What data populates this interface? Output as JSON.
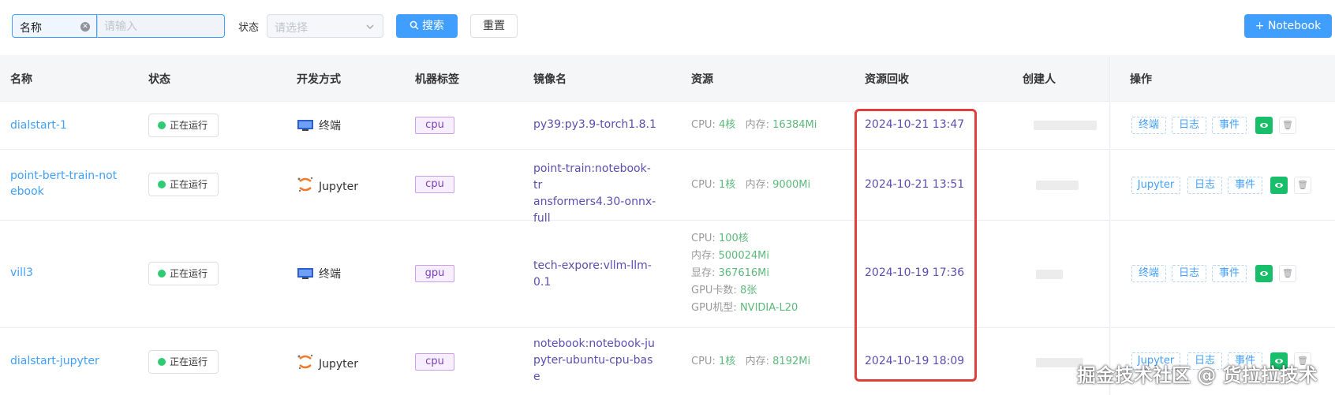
{
  "toolbar": {
    "field_label": "名称",
    "search_placeholder": "请输入",
    "status_label": "状态",
    "status_placeholder": "请选择",
    "search_button": "搜索",
    "reset_button": "重置",
    "new_button": "+ Notebook"
  },
  "table": {
    "headers": {
      "name": "名称",
      "status": "状态",
      "dev_mode": "开发方式",
      "machine_tag": "机器标签",
      "image": "镜像名",
      "resources": "资源",
      "recycle": "资源回收",
      "creator": "创建人",
      "ops": "操作"
    },
    "rows": [
      {
        "name_lines": [
          "dialstart-1"
        ],
        "status": "正在运行",
        "dev_mode": "终端",
        "dev_icon": "terminal-icon",
        "tag": "cpu",
        "image_lines": [
          "py39:py3.9-torch1.8.1"
        ],
        "resources": {
          "cpu_label": "CPU: ",
          "cpu_value": "4核",
          "mem_label": "内存: ",
          "mem_value": "16384Mi"
        },
        "recycle": "2024-10-21 13:47",
        "ops": [
          "终端",
          "日志",
          "事件"
        ]
      },
      {
        "name_lines": [
          "point-bert-train-not",
          "ebook"
        ],
        "status": "正在运行",
        "dev_mode": "Jupyter",
        "dev_icon": "jupyter-icon",
        "tag": "cpu",
        "image_lines": [
          "point-train:notebook-tr",
          "ansformers4.30-onnx-",
          "full"
        ],
        "resources": {
          "cpu_label": "CPU: ",
          "cpu_value": "1核",
          "mem_label": "内存: ",
          "mem_value": "9000Mi"
        },
        "recycle": "2024-10-21 13:51",
        "ops": [
          "Jupyter",
          "日志",
          "事件"
        ]
      },
      {
        "name_lines": [
          "vill3"
        ],
        "status": "正在运行",
        "dev_mode": "终端",
        "dev_icon": "terminal-icon",
        "tag": "gpu",
        "image_lines": [
          "tech-expore:vllm-llm-",
          "0.1"
        ],
        "resources_gpu": [
          {
            "label": "CPU: ",
            "value": "100核"
          },
          {
            "label": "内存: ",
            "value": "500024Mi"
          },
          {
            "label": "显存: ",
            "value": "367616Mi"
          },
          {
            "label": "GPU卡数: ",
            "value": "8张"
          },
          {
            "label": "GPU机型: ",
            "value": "NVIDIA-L20"
          }
        ],
        "recycle": "2024-10-19 17:36",
        "ops": [
          "终端",
          "日志",
          "事件"
        ]
      },
      {
        "name_lines": [
          "dialstart-jupyter"
        ],
        "status": "正在运行",
        "dev_mode": "Jupyter",
        "dev_icon": "jupyter-icon",
        "tag": "cpu",
        "image_lines": [
          "notebook:notebook-ju",
          "pyter-ubuntu-cpu-bas",
          "e"
        ],
        "resources": {
          "cpu_label": "CPU: ",
          "cpu_value": "1核",
          "mem_label": "内存: ",
          "mem_value": "8192Mi"
        },
        "recycle": "2024-10-19 18:09",
        "ops": [
          "Jupyter",
          "日志",
          "事件"
        ]
      }
    ]
  },
  "watermark": "掘金技术社区 @ 货拉拉技术",
  "colors": {
    "accent": "#409eff",
    "running": "#2ecc71",
    "highlight": "#e0403a",
    "resource_value": "#5cb87a"
  }
}
